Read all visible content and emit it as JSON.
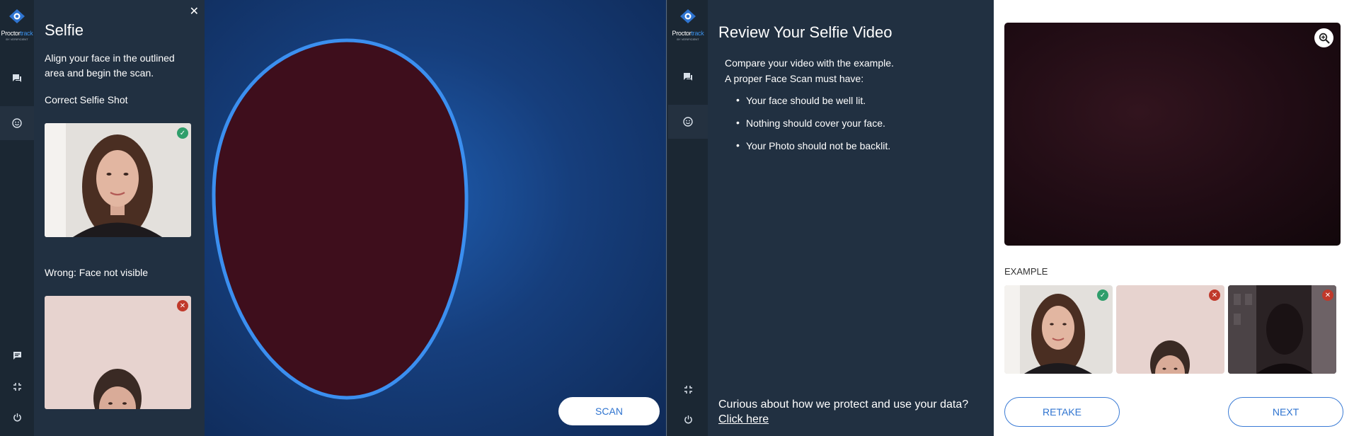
{
  "brand": {
    "name_part1": "Proctor",
    "name_part2": "track",
    "byline": "BY VERIFICIENT"
  },
  "left": {
    "title": "Selfie",
    "description": "Align your face in the outlined area and begin the scan.",
    "correct_label": "Correct Selfie Shot",
    "wrong_label": "Wrong: Face not visible",
    "scan_button": "SCAN",
    "close_icon": "close-icon"
  },
  "right": {
    "title": "Review Your Selfie Video",
    "intro_line1": "Compare your video with the example.",
    "intro_line2": "A proper Face Scan must have:",
    "rules": [
      "Your face should be well lit.",
      "Nothing should cover your face.",
      "Your Photo should not be backlit."
    ],
    "privacy_text": "Curious about how we protect and use your data?",
    "privacy_link": "Click here",
    "example_label": "EXAMPLE",
    "retake_button": "RETAKE",
    "next_button": "NEXT"
  },
  "colors": {
    "accent": "#3a7bd5",
    "ok": "#2f9e6b",
    "bad": "#c0392b",
    "panel": "#213041",
    "rail": "#1b2733"
  }
}
